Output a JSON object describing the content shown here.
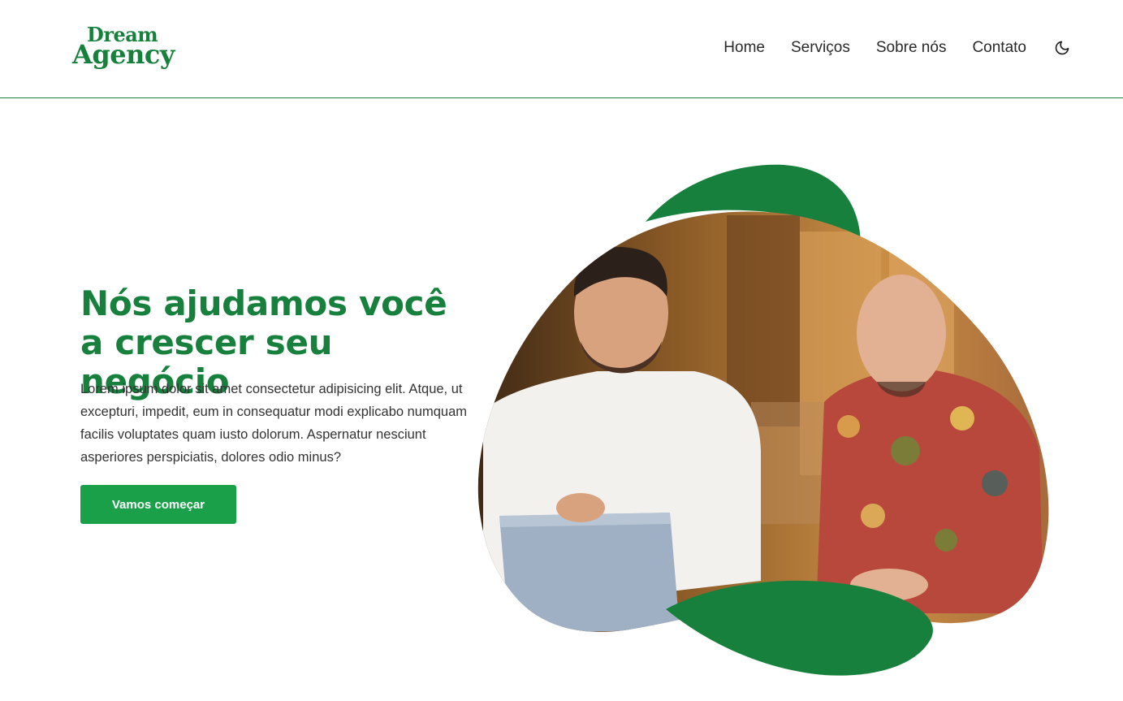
{
  "brand": {
    "logo_line1": "Dream",
    "logo_line2": "Agency",
    "accent_color": "#17803d",
    "button_color": "#1aa049"
  },
  "nav": {
    "items": [
      {
        "label": "Home"
      },
      {
        "label": "Serviços"
      },
      {
        "label": "Sobre nós"
      },
      {
        "label": "Contato"
      }
    ],
    "theme_toggle_icon": "moon-icon"
  },
  "hero": {
    "title": "Nós ajudamos você a crescer seu negócio",
    "description": "Lorem ipsum dolor sit amet consectetur adipisicing elit. Atque, ut excepturi, impedit, eum in consequatur modi explicabo numquam facilis voluptates quam iusto dolorum. Aspernatur nesciunt asperiores perspiciatis, dolores odio minus?",
    "cta_label": "Vamos começar",
    "image_subject": "two-men-talking-with-laptop-photo"
  }
}
